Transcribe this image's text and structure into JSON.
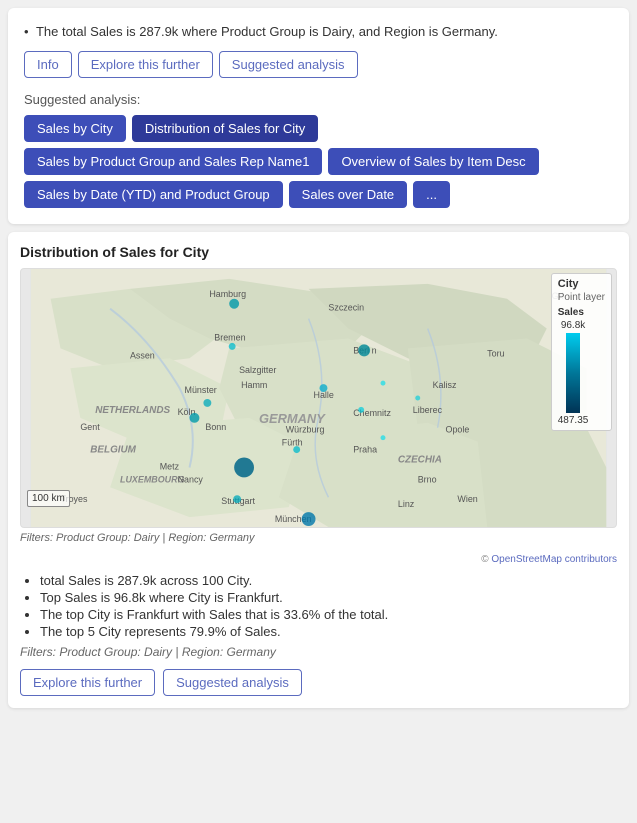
{
  "top_card": {
    "info_text": "The total Sales is 287.9k where Product Group is Dairy, and Region is Germany.",
    "buttons": {
      "info": "Info",
      "explore": "Explore this further",
      "suggested": "Suggested analysis"
    },
    "suggested_label": "Suggested analysis:",
    "analysis_buttons": [
      "Sales by City",
      "Distribution of Sales for City",
      "Sales by Product Group and Sales Rep Name1",
      "Overview of Sales by Item Desc",
      "Sales by Date (YTD) and Product Group",
      "Sales over Date",
      "..."
    ]
  },
  "map_card": {
    "title": "Distribution of Sales for City",
    "legend": {
      "city_label": "City",
      "point_layer": "Point layer",
      "sales_label": "Sales",
      "max_value": "96.8k",
      "min_value": "487.35"
    },
    "scale": "100 km",
    "filter_text": "Filters: Product Group: Dairy | Region: Germany",
    "attribution": "© OpenStreetMap contributors",
    "bullets": [
      "total Sales is 287.9k across 100 City.",
      "Top Sales is 96.8k where City is Frankfurt.",
      "The top City is Frankfurt with Sales that is 33.6% of the total.",
      "The top 5 City represents 79.9% of Sales."
    ],
    "filter_bottom": "Filters: Product Group: Dairy | Region: Germany",
    "explore_btn": "Explore this further",
    "suggested_btn": "Suggested analysis"
  }
}
